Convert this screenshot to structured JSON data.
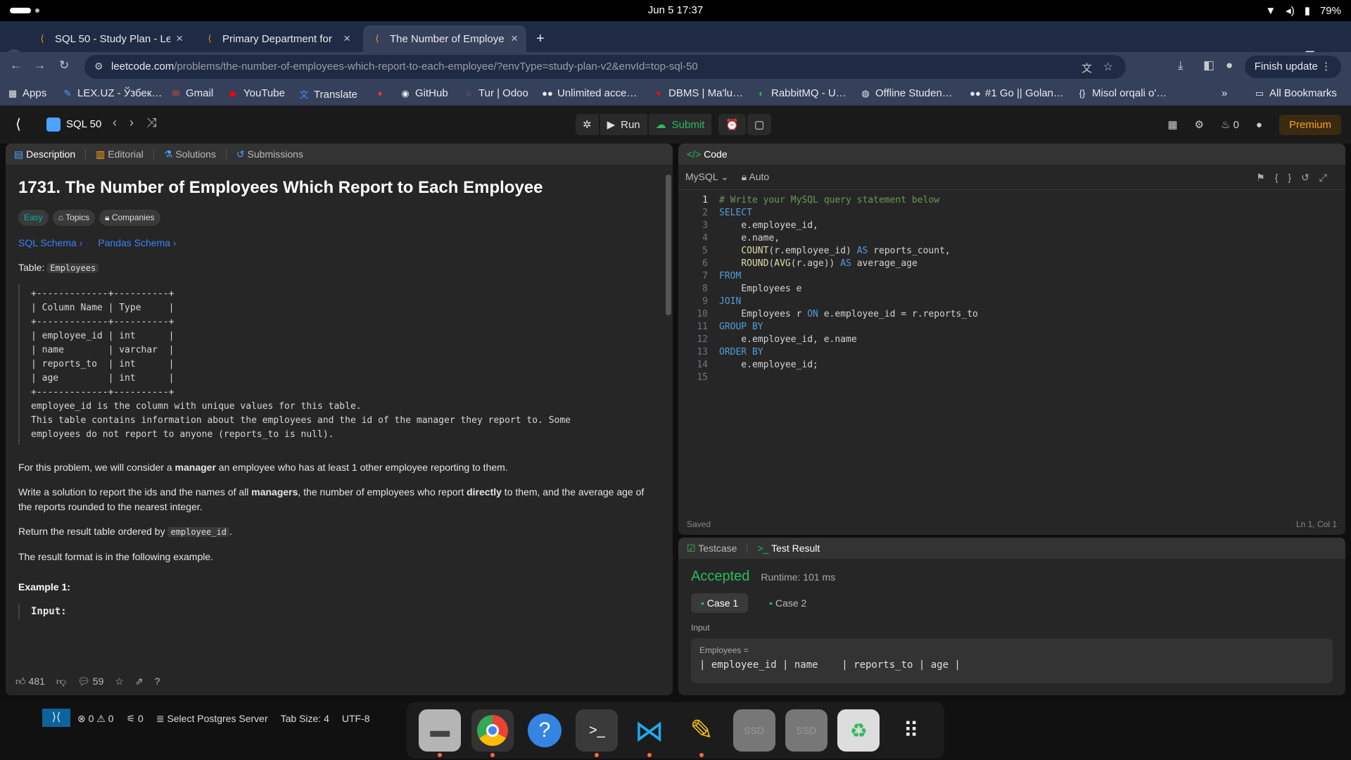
{
  "os": {
    "clock": "Jun 5  17:37",
    "battery": "79%"
  },
  "tabs": [
    {
      "title": "SQL 50 - Study Plan - Lee"
    },
    {
      "title": "Primary Department for"
    },
    {
      "title": "The Number of Employe"
    }
  ],
  "omnibox": {
    "url_host": "leetcode.com",
    "url_rest": "/problems/the-number-of-employees-which-report-to-each-employee/?envType=study-plan-v2&envId=top-sql-50"
  },
  "finish_update": "Finish update",
  "bookmarks": [
    {
      "label": "Apps"
    },
    {
      "label": "LEX.UZ - Ўзбек…"
    },
    {
      "label": "Gmail"
    },
    {
      "label": "YouTube"
    },
    {
      "label": "Translate"
    },
    {
      "label": "GitHub"
    },
    {
      "label": "Tur | Odoo"
    },
    {
      "label": "Unlimited acce…"
    },
    {
      "label": "DBMS | Ma'lu…"
    },
    {
      "label": "RabbitMQ - U…"
    },
    {
      "label": "Offline Studen…"
    },
    {
      "label": "#1 Go || Golan…"
    },
    {
      "label": "Misol orqali o'…"
    }
  ],
  "all_bookmarks": "All Bookmarks",
  "lc_nav": {
    "study_plan": "SQL 50",
    "run": "Run",
    "submit": "Submit",
    "streak": "0",
    "premium": "Premium"
  },
  "desc_tabs": {
    "description": "Description",
    "editorial": "Editorial",
    "solutions": "Solutions",
    "submissions": "Submissions"
  },
  "problem": {
    "title": "1731. The Number of Employees Which Report to Each Employee",
    "difficulty": "Easy",
    "topics": "Topics",
    "companies": "Companies",
    "sql_schema": "SQL Schema",
    "pandas_schema": "Pandas Schema",
    "table_label": "Table:",
    "table_name": "Employees",
    "table_block": "+-------------+----------+\n| Column Name | Type     |\n+-------------+----------+\n| employee_id | int      |\n| name        | varchar  |\n| reports_to  | int      |\n| age         | int      |\n+-------------+----------+\nemployee_id is the column with unique values for this table.\nThis table contains information about the employees and the id of the manager they report to. Some\nemployees do not report to anyone (reports_to is null).",
    "p1_a": "For this problem, we will consider a ",
    "p1_b": "manager",
    "p1_c": " an employee who has at least 1 other employee reporting to them.",
    "p2_a": "Write a solution to report the ids and the names of all ",
    "p2_b": "managers",
    "p2_c": ", the number of employees who report ",
    "p2_d": "directly",
    "p2_e": " to them, and the average age of the reports rounded to the nearest integer.",
    "p3_a": "Return the result table ordered by ",
    "p3_code": "employee_id",
    "p3_b": ".",
    "p4": "The result format is in the following example.",
    "example": "Example 1:",
    "input_label": "Input:"
  },
  "desc_footer": {
    "likes": "481",
    "comments": "59"
  },
  "code_panel": {
    "title": "Code",
    "language": "MySQL",
    "mode": "Auto",
    "saved": "Saved",
    "cursor": "Ln 1, Col 1"
  },
  "code_lines": [
    "# Write your MySQL query statement below",
    "SELECT",
    "    e.employee_id,",
    "    e.name,",
    "    COUNT(r.employee_id) AS reports_count,",
    "    ROUND(AVG(r.age)) AS average_age",
    "FROM",
    "    Employees e",
    "JOIN",
    "    Employees r ON e.employee_id = r.reports_to",
    "GROUP BY",
    "    e.employee_id, e.name",
    "ORDER BY",
    "    e.employee_id;",
    ""
  ],
  "result_panel": {
    "testcase": "Testcase",
    "test_result": "Test Result",
    "status": "Accepted",
    "runtime": "Runtime: 101 ms",
    "case1": "Case 1",
    "case2": "Case 2",
    "input_label": "Input",
    "var_name": "Employees =",
    "row": "| employee_id | name    | reports_to | age |"
  },
  "vscode_status": {
    "errors": "0",
    "warnings": "0",
    "ports": "0",
    "server": "Select Postgres Server",
    "tab_size": "Tab Size: 4",
    "encoding": "UTF-8"
  },
  "colors": {
    "accent": "#ffa116",
    "accepted": "#2cbb5d",
    "link": "#3b82f6",
    "easy": "#00b8a3"
  }
}
